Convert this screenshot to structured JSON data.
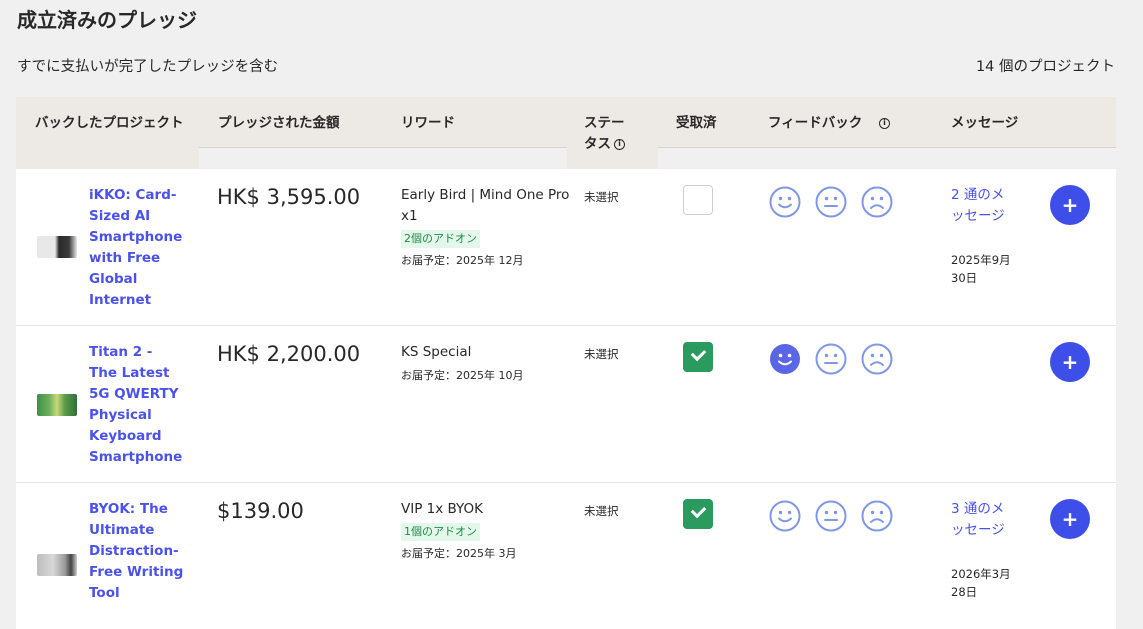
{
  "page": {
    "title": "成立済みのプレッジ",
    "subtitle": "すでに支払いが完了したプレッジを含む",
    "project_count": "14 個のプロジェクト"
  },
  "table": {
    "headers": {
      "project": "バックしたプロジェクト",
      "amount": "プレッジされた金額",
      "reward": "リワード",
      "status": "ステータス",
      "received": "受取済",
      "feedback": "フィードバック",
      "messages": "メッセージ"
    },
    "rows": [
      {
        "project": "iKKO: Card-Sized AI Smartphone with Free Global Internet",
        "amount": "HK$ 3,595.00",
        "reward": "Early Bird | Mind One Pro x1",
        "addons": "2個のアドオン",
        "delivery": "お届予定：2025年 12月",
        "status": "未選択",
        "received": false,
        "feedback_selected": "none",
        "messages": "2 通のメッセージ",
        "message_date": "2025年9月30日"
      },
      {
        "project": "Titan 2 - The Latest 5G QWERTY Physical Keyboard Smartphone",
        "amount": "HK$ 2,200.00",
        "reward": "KS Special",
        "addons": "",
        "delivery": "お届予定：2025年 10月",
        "status": "未選択",
        "received": true,
        "feedback_selected": "happy",
        "messages": "",
        "message_date": ""
      },
      {
        "project": "BYOK: The Ultimate Distraction-Free Writing Tool",
        "amount": "$139.00",
        "reward": "VIP 1x BYOK",
        "addons": "1個のアドオン",
        "delivery": "お届予定：2025年 3月",
        "status": "未選択",
        "received": true,
        "feedback_selected": "none",
        "messages": "3 通のメッセージ",
        "message_date": "2026年3月28日"
      }
    ]
  },
  "colors": {
    "link": "#4a52e8",
    "accent_button": "#3e4ee8",
    "check_green": "#2b9a5e",
    "addon_bg": "#e3f7ea",
    "face_outline": "#7f98e6",
    "face_selected": "#5b66e6"
  },
  "icons": {
    "info": "info-circle-icon",
    "happy": "smiley-face-icon",
    "neutral": "neutral-face-icon",
    "sad": "sad-face-icon",
    "add": "plus-icon",
    "check": "checkmark-icon"
  }
}
